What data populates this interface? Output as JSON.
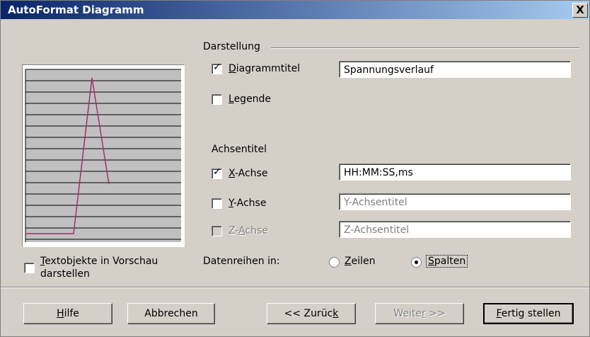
{
  "window": {
    "title": "AutoFormat Diagramm",
    "close_glyph": "X"
  },
  "darstellung": {
    "group_label": "Darstellung",
    "diagrammtitel": {
      "label": "Diagrammtitel",
      "checked": true,
      "value": "Spannungsverlauf"
    },
    "legende": {
      "label": "Legende",
      "checked": false
    }
  },
  "achsentitel": {
    "group_label": "Achsentitel",
    "x": {
      "label": "X-Achse",
      "checked": true,
      "value": "HH:MM:SS,ms"
    },
    "y": {
      "label": "Y-Achse",
      "checked": false,
      "placeholder": "Y-Achsentitel"
    },
    "z": {
      "label": "Z-Achse",
      "checked": false,
      "disabled": true,
      "placeholder": "Z-Achsentitel"
    }
  },
  "preview_option": {
    "label_line1": "Textobjekte in Vorschau",
    "label_line2": "darstellen",
    "checked": false
  },
  "datenreihen": {
    "label": "Datenreihen in:",
    "options": [
      "Zeilen",
      "Spalten"
    ],
    "selected": "Spalten"
  },
  "buttons": {
    "help": "Hilfe",
    "cancel": "Abbrechen",
    "back": "<< Zurück",
    "next": "Weiter >>",
    "finish": "Fertig stellen"
  },
  "preview_line_color": "#a0306a"
}
